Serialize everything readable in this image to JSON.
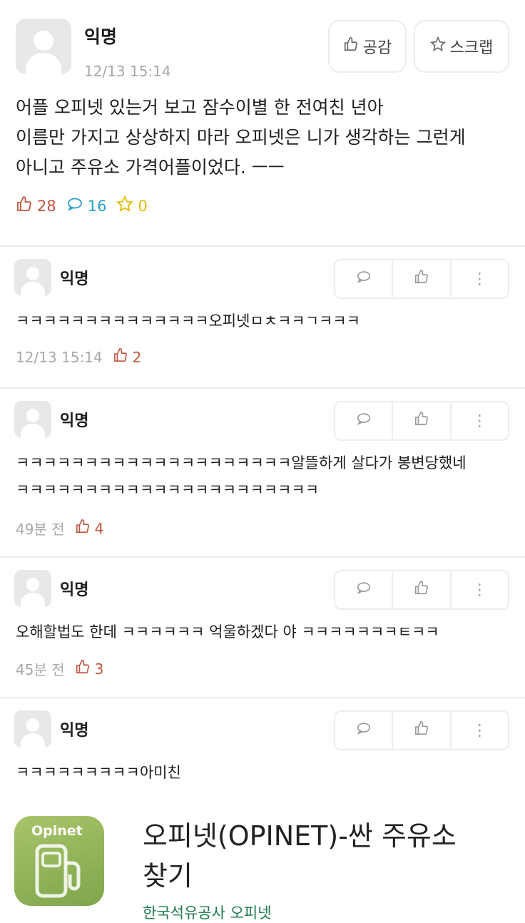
{
  "post": {
    "author": "익명",
    "time": "12/13 15:14",
    "like_button_label": "공감",
    "scrap_button_label": "스크랩",
    "content": "어플 오피넷 있는거 보고 잠수이별 한 전여친 년아\n이름만 가지고 상상하지 마라 오피넷은 니가 생각하는 그런게\n아니고 주유소 가격어플이었다. ㅡㅡ",
    "stats": {
      "likes": "28",
      "comments": "16",
      "scraps": "0"
    },
    "colors": {
      "likes": "#c0553e",
      "comments": "#2aa0c8",
      "scraps": "#e6b800"
    }
  },
  "comments": [
    {
      "author": "익명",
      "text": "ㅋㅋㅋㅋㅋㅋㅋㅋㅋㅋㅋㅋㅋㅋ오피넷ㅁㅊㅋㅋㄱㅋㅋㅋ",
      "time": "12/13 15:14",
      "likes": "2"
    },
    {
      "author": "익명",
      "text": "ㅋㅋㅋㅋㅋㅋㅋㅋㅋㅋㅋㅋㅋㅋㅋㅋㅋㅋㅋㅋ알뜰하게 살다가 봉변당했네\nㅋㅋㅋㅋㅋㅋㅋㅋㅋㅋㅋㅋㅋㅋㅋㅋㅋㅋㅋㅋㅋㅋ",
      "time": "49분 전",
      "likes": "4"
    },
    {
      "author": "익명",
      "text": "오해할법도 한데 ㅋㅋㅋㅋㅋㅋ 억울하겠다 야 ㅋㅋㅋㅋㅋㅋㅋㅌㅋㅋ",
      "time": "45분 전",
      "likes": "3"
    },
    {
      "author": "익명",
      "text": "ㅋㅋㅋㅋㅋㅋㅋㅋㅋ아미친"
    }
  ],
  "app_banner": {
    "icon_label": "Opinet",
    "title": "오피넷(OPINET)-싼 주유소\n찾기",
    "developer": "한국석유공사 오피넷"
  }
}
